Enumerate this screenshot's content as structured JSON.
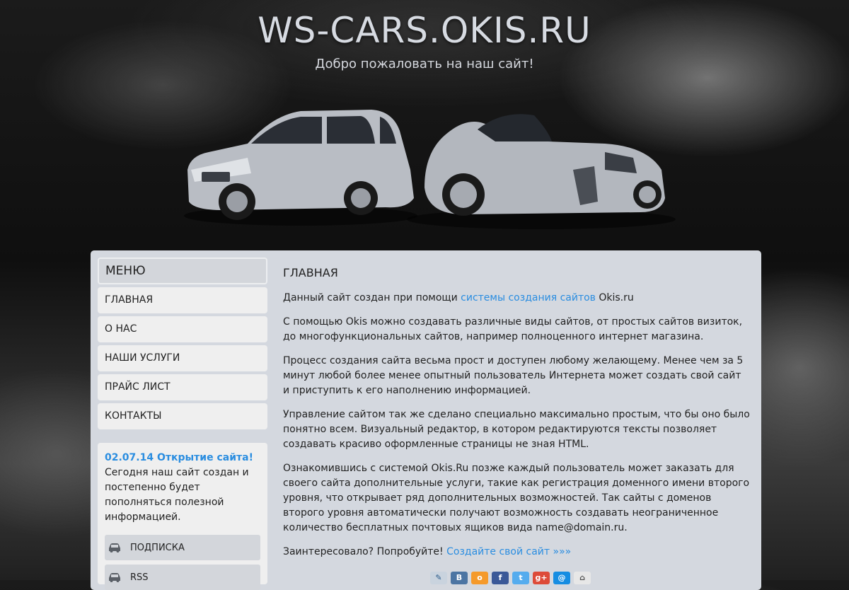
{
  "header": {
    "title": "WS-CARS.OKIS.RU",
    "subtitle": "Добро пожаловать на наш сайт!"
  },
  "menu": {
    "heading": "МЕНЮ",
    "items": [
      {
        "label": "ГЛАВНАЯ"
      },
      {
        "label": "О НАС"
      },
      {
        "label": "НАШИ УСЛУГИ"
      },
      {
        "label": "ПРАЙС ЛИСТ"
      },
      {
        "label": "КОНТАКТЫ"
      }
    ]
  },
  "news": {
    "title": "02.07.14 Открытие сайта!",
    "text": "Сегодня наш сайт создан и постепенно будет пополняться полезной информацией.",
    "subscribe_label": "ПОДПИСКА",
    "rss_label": "RSS",
    "button_icon": "car-icon"
  },
  "content": {
    "heading": "ГЛАВНАЯ",
    "p1_pre": "Данный сайт создан при помощи ",
    "p1_link": "системы создания сайтов",
    "p1_post": " Okis.ru",
    "p2": "С помощью Okis можно создавать различные виды сайтов, от простых сайтов визиток, до многофункциональных сайтов, например полноценного интернет магазина.",
    "p3": "Процесс создания сайта весьма прост и доступен любому желающему. Менее чем за 5 минут любой более менее опытный пользователь Интернета может создать свой сайт и приступить к его наполнению информацией.",
    "p4": "Управление сайтом так же сделано специально максимально простым, что бы оно было понятно всем. Визуальный редактор, в котором редактируются тексты позволяет создавать красиво оформленные страницы не зная HTML.",
    "p5": "Ознакомившись с системой Okis.Ru позже каждый пользователь может заказать для своего сайта дополнительные услуги, такие как регистрация доменного имени второго уровня, что открывает ряд дополнительных возможностей. Так сайты с доменов второго уровня автоматически получают возможность создавать неограниченное количество бесплатных почтовых ящиков вида name@domain.ru.",
    "p6_pre": "Заинтересовало? Попробуйте! ",
    "p6_link": "Создайте свой сайт »»»"
  },
  "social_icons": [
    "livejournal-icon",
    "vkontakte-icon",
    "odnoklassniki-icon",
    "facebook-icon",
    "twitter-icon",
    "googleplus-icon",
    "mailru-icon",
    "home-icon"
  ],
  "colors": {
    "accent": "#2a8de0",
    "panel": "#d4d8df",
    "menu_item": "#efefef"
  }
}
